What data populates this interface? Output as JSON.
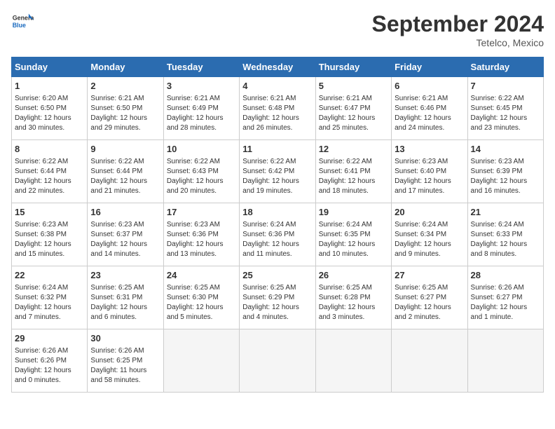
{
  "header": {
    "logo_line1": "General",
    "logo_line2": "Blue",
    "month": "September 2024",
    "location": "Tetelco, Mexico"
  },
  "days_of_week": [
    "Sunday",
    "Monday",
    "Tuesday",
    "Wednesday",
    "Thursday",
    "Friday",
    "Saturday"
  ],
  "weeks": [
    [
      {
        "day": "1",
        "info": "Sunrise: 6:20 AM\nSunset: 6:50 PM\nDaylight: 12 hours\nand 30 minutes."
      },
      {
        "day": "2",
        "info": "Sunrise: 6:21 AM\nSunset: 6:50 PM\nDaylight: 12 hours\nand 29 minutes."
      },
      {
        "day": "3",
        "info": "Sunrise: 6:21 AM\nSunset: 6:49 PM\nDaylight: 12 hours\nand 28 minutes."
      },
      {
        "day": "4",
        "info": "Sunrise: 6:21 AM\nSunset: 6:48 PM\nDaylight: 12 hours\nand 26 minutes."
      },
      {
        "day": "5",
        "info": "Sunrise: 6:21 AM\nSunset: 6:47 PM\nDaylight: 12 hours\nand 25 minutes."
      },
      {
        "day": "6",
        "info": "Sunrise: 6:21 AM\nSunset: 6:46 PM\nDaylight: 12 hours\nand 24 minutes."
      },
      {
        "day": "7",
        "info": "Sunrise: 6:22 AM\nSunset: 6:45 PM\nDaylight: 12 hours\nand 23 minutes."
      }
    ],
    [
      {
        "day": "8",
        "info": "Sunrise: 6:22 AM\nSunset: 6:44 PM\nDaylight: 12 hours\nand 22 minutes."
      },
      {
        "day": "9",
        "info": "Sunrise: 6:22 AM\nSunset: 6:44 PM\nDaylight: 12 hours\nand 21 minutes."
      },
      {
        "day": "10",
        "info": "Sunrise: 6:22 AM\nSunset: 6:43 PM\nDaylight: 12 hours\nand 20 minutes."
      },
      {
        "day": "11",
        "info": "Sunrise: 6:22 AM\nSunset: 6:42 PM\nDaylight: 12 hours\nand 19 minutes."
      },
      {
        "day": "12",
        "info": "Sunrise: 6:22 AM\nSunset: 6:41 PM\nDaylight: 12 hours\nand 18 minutes."
      },
      {
        "day": "13",
        "info": "Sunrise: 6:23 AM\nSunset: 6:40 PM\nDaylight: 12 hours\nand 17 minutes."
      },
      {
        "day": "14",
        "info": "Sunrise: 6:23 AM\nSunset: 6:39 PM\nDaylight: 12 hours\nand 16 minutes."
      }
    ],
    [
      {
        "day": "15",
        "info": "Sunrise: 6:23 AM\nSunset: 6:38 PM\nDaylight: 12 hours\nand 15 minutes."
      },
      {
        "day": "16",
        "info": "Sunrise: 6:23 AM\nSunset: 6:37 PM\nDaylight: 12 hours\nand 14 minutes."
      },
      {
        "day": "17",
        "info": "Sunrise: 6:23 AM\nSunset: 6:36 PM\nDaylight: 12 hours\nand 13 minutes."
      },
      {
        "day": "18",
        "info": "Sunrise: 6:24 AM\nSunset: 6:36 PM\nDaylight: 12 hours\nand 11 minutes."
      },
      {
        "day": "19",
        "info": "Sunrise: 6:24 AM\nSunset: 6:35 PM\nDaylight: 12 hours\nand 10 minutes."
      },
      {
        "day": "20",
        "info": "Sunrise: 6:24 AM\nSunset: 6:34 PM\nDaylight: 12 hours\nand 9 minutes."
      },
      {
        "day": "21",
        "info": "Sunrise: 6:24 AM\nSunset: 6:33 PM\nDaylight: 12 hours\nand 8 minutes."
      }
    ],
    [
      {
        "day": "22",
        "info": "Sunrise: 6:24 AM\nSunset: 6:32 PM\nDaylight: 12 hours\nand 7 minutes."
      },
      {
        "day": "23",
        "info": "Sunrise: 6:25 AM\nSunset: 6:31 PM\nDaylight: 12 hours\nand 6 minutes."
      },
      {
        "day": "24",
        "info": "Sunrise: 6:25 AM\nSunset: 6:30 PM\nDaylight: 12 hours\nand 5 minutes."
      },
      {
        "day": "25",
        "info": "Sunrise: 6:25 AM\nSunset: 6:29 PM\nDaylight: 12 hours\nand 4 minutes."
      },
      {
        "day": "26",
        "info": "Sunrise: 6:25 AM\nSunset: 6:28 PM\nDaylight: 12 hours\nand 3 minutes."
      },
      {
        "day": "27",
        "info": "Sunrise: 6:25 AM\nSunset: 6:27 PM\nDaylight: 12 hours\nand 2 minutes."
      },
      {
        "day": "28",
        "info": "Sunrise: 6:26 AM\nSunset: 6:27 PM\nDaylight: 12 hours\nand 1 minute."
      }
    ],
    [
      {
        "day": "29",
        "info": "Sunrise: 6:26 AM\nSunset: 6:26 PM\nDaylight: 12 hours\nand 0 minutes."
      },
      {
        "day": "30",
        "info": "Sunrise: 6:26 AM\nSunset: 6:25 PM\nDaylight: 11 hours\nand 58 minutes."
      },
      {
        "day": "",
        "info": ""
      },
      {
        "day": "",
        "info": ""
      },
      {
        "day": "",
        "info": ""
      },
      {
        "day": "",
        "info": ""
      },
      {
        "day": "",
        "info": ""
      }
    ]
  ]
}
